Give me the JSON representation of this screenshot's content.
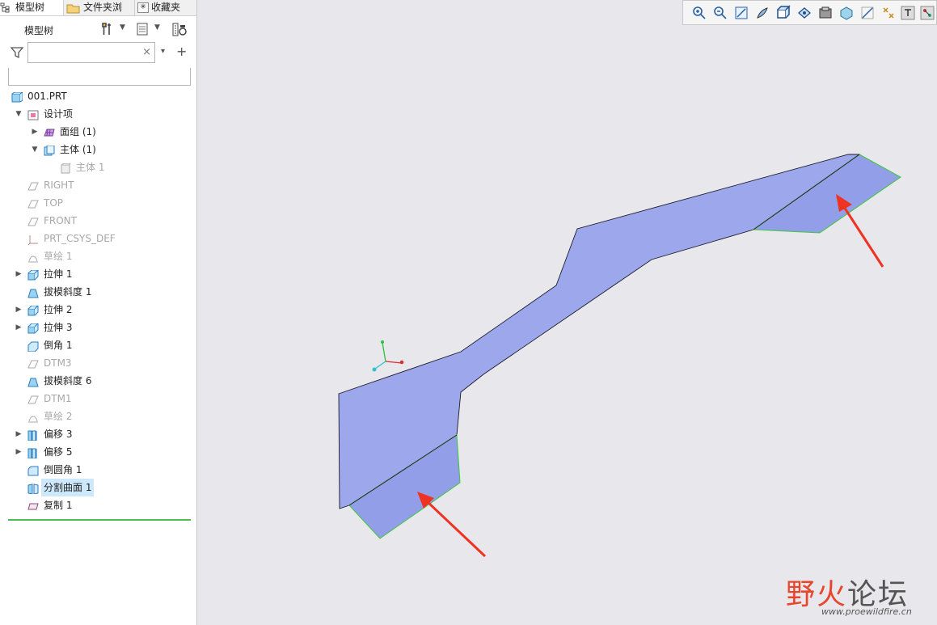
{
  "tabs": [
    {
      "label": "模型树",
      "icon": "model-tree-icon"
    },
    {
      "label": "文件夹浏",
      "icon": "folder-browser-icon"
    },
    {
      "label": "收藏夹",
      "icon": "favorites-icon"
    }
  ],
  "tree_header": {
    "title": "模型树",
    "settings_icon": "tree-settings-icon",
    "columns_icon": "tree-columns-icon",
    "show_icon": "show-icon"
  },
  "filter": {
    "icon": "filter-icon",
    "search_value": "",
    "clear_icon": "×",
    "dropdown_icon": "▾",
    "add_icon": "+"
  },
  "tree": {
    "items": [
      {
        "label": "001.PRT",
        "icon": "part-icon",
        "state": "normal"
      },
      {
        "label": "设计项",
        "icon": "design-items-icon",
        "state": "normal",
        "expanded": true
      },
      {
        "label": "面组 (1)",
        "icon": "quilt-icon",
        "state": "normal",
        "expanded": false
      },
      {
        "label": "主体 (1)",
        "icon": "body-icon",
        "state": "normal",
        "expanded": true
      },
      {
        "label": "主体 1",
        "icon": "body-item-icon",
        "state": "muted"
      },
      {
        "label": "RIGHT",
        "icon": "datum-plane-icon",
        "state": "muted"
      },
      {
        "label": "TOP",
        "icon": "datum-plane-icon",
        "state": "muted"
      },
      {
        "label": "FRONT",
        "icon": "datum-plane-icon",
        "state": "muted"
      },
      {
        "label": "PRT_CSYS_DEF",
        "icon": "csys-icon",
        "state": "muted"
      },
      {
        "label": "草绘 1",
        "icon": "sketch-icon",
        "state": "muted"
      },
      {
        "label": "拉伸 1",
        "icon": "extrude-icon",
        "state": "normal",
        "expanded": false
      },
      {
        "label": "拔模斜度 1",
        "icon": "draft-icon",
        "state": "normal"
      },
      {
        "label": "拉伸 2",
        "icon": "extrude-icon",
        "state": "normal",
        "expanded": false
      },
      {
        "label": "拉伸 3",
        "icon": "extrude-icon",
        "state": "normal",
        "expanded": false
      },
      {
        "label": "倒角 1",
        "icon": "chamfer-icon",
        "state": "normal"
      },
      {
        "label": "DTM3",
        "icon": "datum-plane-icon",
        "state": "muted"
      },
      {
        "label": "拔模斜度 6",
        "icon": "draft-icon",
        "state": "normal"
      },
      {
        "label": "DTM1",
        "icon": "datum-plane-icon",
        "state": "muted"
      },
      {
        "label": "草绘 2",
        "icon": "sketch-icon",
        "state": "muted"
      },
      {
        "label": "偏移 3",
        "icon": "offset-icon",
        "state": "normal",
        "expanded": false
      },
      {
        "label": "偏移 5",
        "icon": "offset-icon",
        "state": "normal",
        "expanded": false
      },
      {
        "label": "倒圆角 1",
        "icon": "round-icon",
        "state": "normal"
      },
      {
        "label": "分割曲面 1",
        "icon": "split-surface-icon",
        "state": "selected"
      },
      {
        "label": "复制 1",
        "icon": "copy-icon",
        "state": "normal"
      }
    ]
  },
  "view_toolbar": {
    "buttons": [
      "zoom-in-icon",
      "zoom-out-icon",
      "refit-icon",
      "repaint-icon",
      "saved-orientations-icon",
      "saved-views-icon",
      "display-style-icon",
      "view-manager-icon",
      "datum-display-icon",
      "annotation-display-icon",
      "spin-center-icon",
      "hide-show-icon"
    ]
  },
  "colors": {
    "surface_fill": "#9da8ec",
    "surface_fill_dark": "#8e99e6",
    "edge_green": "#3cc83c",
    "arrow_red": "#ee3322",
    "selection": "#cde8fb"
  },
  "watermark": {
    "text_part1": "野",
    "text_part2": "火",
    "text_part3": "论坛",
    "url": "www.proewildfire.cn"
  }
}
